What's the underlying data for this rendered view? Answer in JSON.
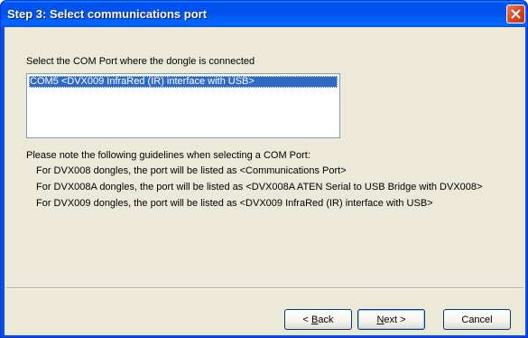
{
  "window": {
    "title": "Step 3: Select communications port",
    "close_icon": "close-icon"
  },
  "content": {
    "prompt": "Select the COM Port where the dongle is connected",
    "ports": [
      {
        "label": "COM5 <DVX009 InfraRed (IR) interface with USB>",
        "selected": true
      }
    ],
    "note": "Please note the following guidelines when selecting a COM Port:",
    "guidelines": [
      "For DVX008 dongles, the port will be listed as <Communications Port>",
      "For DVX008A dongles, the port will be listed as <DVX008A ATEN Serial to USB Bridge with DVX008>",
      "For DVX009 dongles, the port will be listed as <DVX009 InfraRed (IR) interface with USB>"
    ]
  },
  "buttons": {
    "back_accel": "B",
    "back_rest": "ack",
    "back_prefix": "< ",
    "next_accel": "N",
    "next_rest": "ext >",
    "cancel": "Cancel"
  },
  "colors": {
    "titlebar": "#0054e3",
    "selection": "#316ac5",
    "close_button": "#d9431f",
    "dialog_background": "#ece9d8"
  }
}
